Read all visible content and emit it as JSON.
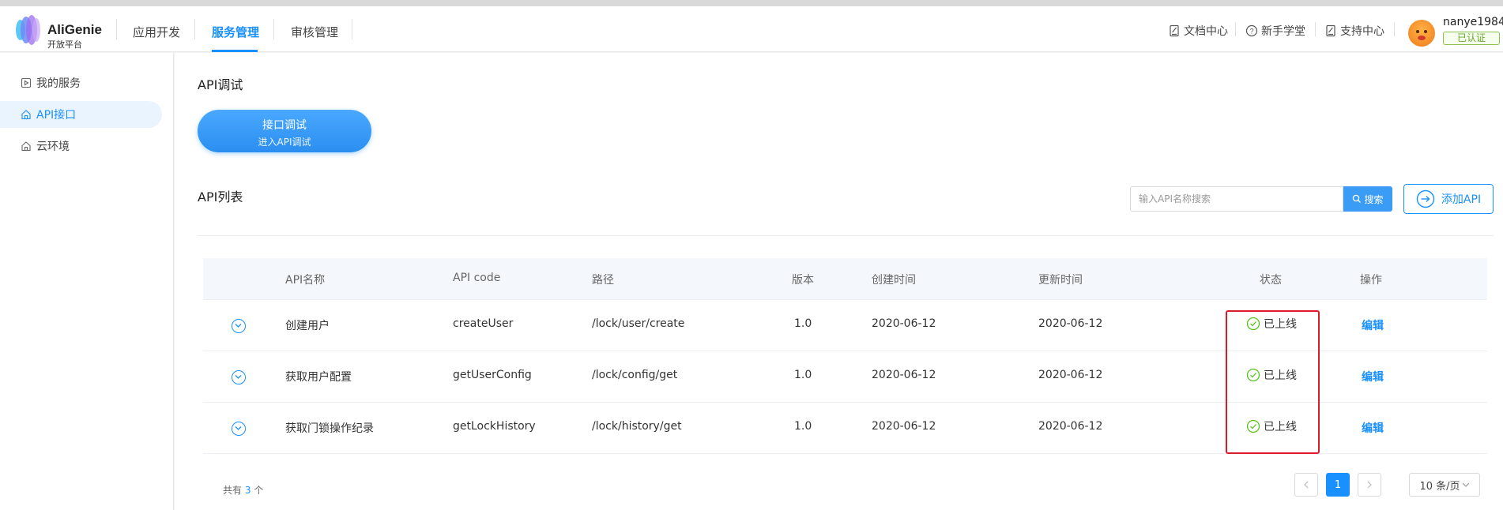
{
  "header": {
    "brand_title": "AliGenie",
    "brand_subtitle": "开放平台",
    "nav": [
      {
        "label": "应用开发"
      },
      {
        "label": "服务管理"
      },
      {
        "label": "审核管理"
      }
    ],
    "links": [
      {
        "label": "文档中心",
        "icon": "document-icon"
      },
      {
        "label": "新手学堂",
        "icon": "help-circle-icon"
      },
      {
        "label": "支持中心",
        "icon": "support-icon"
      }
    ],
    "username": "nanye1984",
    "cert_badge": "已认证"
  },
  "sidebar": {
    "items": [
      {
        "label": "我的服务",
        "icon": "play-square-icon"
      },
      {
        "label": "API接口",
        "icon": "home-icon"
      },
      {
        "label": "云环境",
        "icon": "home-icon"
      }
    ]
  },
  "main": {
    "debug_title": "API调试",
    "debug_button": {
      "line1": "接口调试",
      "line2": "进入API调试"
    },
    "list_title": "API列表",
    "search_placeholder": "输入API名称搜索",
    "search_button": "搜索",
    "add_button": "添加API"
  },
  "table": {
    "columns": [
      "API名称",
      "API code",
      "路径",
      "版本",
      "创建时间",
      "更新时间",
      "状态",
      "操作"
    ],
    "rows": [
      {
        "name": "创建用户",
        "code": "createUser",
        "path": "/lock/user/create",
        "version": "1.0",
        "created": "2020-06-12",
        "updated": "2020-06-12",
        "status": "已上线",
        "action": "编辑"
      },
      {
        "name": "获取用户配置",
        "code": "getUserConfig",
        "path": "/lock/config/get",
        "version": "1.0",
        "created": "2020-06-12",
        "updated": "2020-06-12",
        "status": "已上线",
        "action": "编辑"
      },
      {
        "name": "获取门锁操作纪录",
        "code": "getLockHistory",
        "path": "/lock/history/get",
        "version": "1.0",
        "created": "2020-06-12",
        "updated": "2020-06-12",
        "status": "已上线",
        "action": "编辑"
      }
    ],
    "total_prefix": "共有",
    "total_count": "3",
    "total_suffix": "个",
    "current_page": "1",
    "page_size": "10 条/页"
  },
  "colors": {
    "accent": "#1890ff",
    "success": "#52c41a",
    "highlight": "#e0182e"
  }
}
